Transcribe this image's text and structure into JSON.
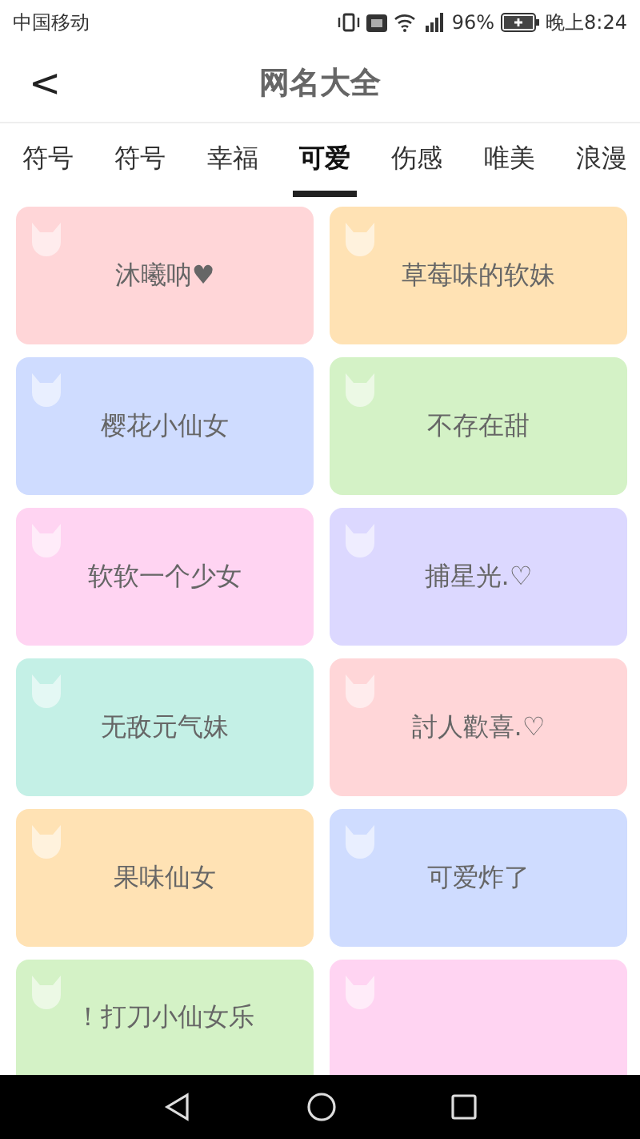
{
  "status_bar": {
    "carrier": "中国移动",
    "battery": "96%",
    "time": "晚上8:24"
  },
  "header": {
    "back": "<",
    "title": "网名大全"
  },
  "tabs": [
    {
      "label": "符号",
      "selected": false
    },
    {
      "label": "符号",
      "selected": false
    },
    {
      "label": "幸福",
      "selected": false
    },
    {
      "label": "可爱",
      "selected": true
    },
    {
      "label": "伤感",
      "selected": false
    },
    {
      "label": "唯美",
      "selected": false
    },
    {
      "label": "浪漫",
      "selected": false
    }
  ],
  "cards": [
    {
      "name": "沐曦呐♥",
      "color": "#ffd6d8"
    },
    {
      "name": "草莓味的软妹",
      "color": "#ffe2b4"
    },
    {
      "name": "樱花小仙女",
      "color": "#cfdcff"
    },
    {
      "name": "不存在甜",
      "color": "#d4f2c6"
    },
    {
      "name": "软软一个少女",
      "color": "#ffd4f2"
    },
    {
      "name": "捕星光.♡",
      "color": "#dcd8ff"
    },
    {
      "name": "无敌元气妹",
      "color": "#c4f0e6"
    },
    {
      "name": "討人歡喜.♡",
      "color": "#ffd6d8"
    },
    {
      "name": "果味仙女",
      "color": "#ffe2b4"
    },
    {
      "name": "可爱炸了",
      "color": "#cfdcff"
    },
    {
      "name": "！打刀小仙女乐",
      "color": "#d4f2c6"
    },
    {
      "color": "#ffd4f2"
    }
  ]
}
